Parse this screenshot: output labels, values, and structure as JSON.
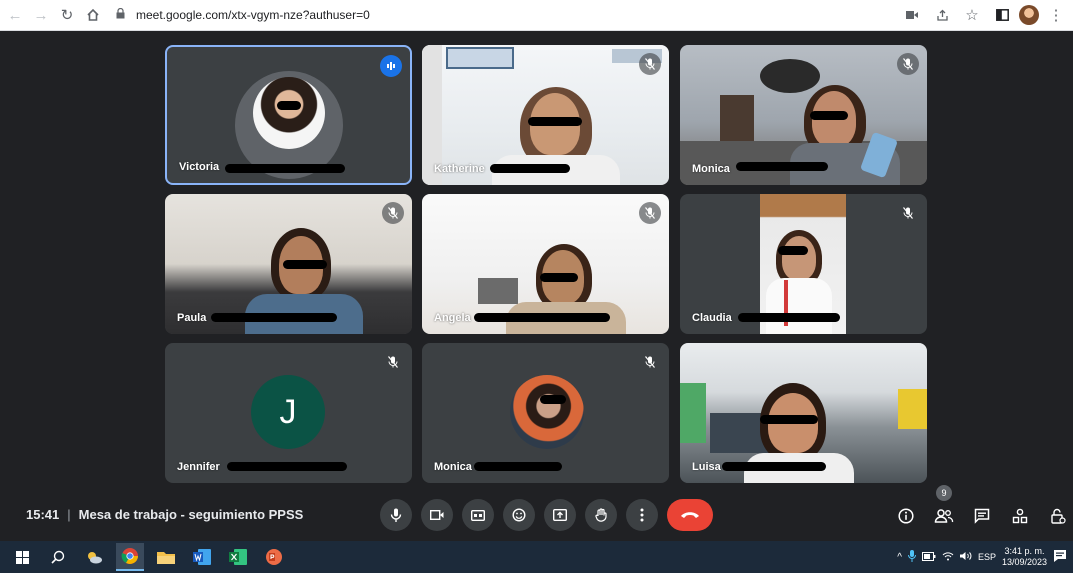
{
  "browser": {
    "url": "meet.google.com/xtx-vgym-nze?authuser=0"
  },
  "participants": [
    {
      "name": "Victoria",
      "speaking": true
    },
    {
      "name": "Katherine",
      "muted": true
    },
    {
      "name": "Monica",
      "muted": true
    },
    {
      "name": "Paula",
      "muted": true
    },
    {
      "name": "Angela",
      "muted": true
    },
    {
      "name": "Claudia",
      "muted": true
    },
    {
      "name": "Jennifer",
      "muted": true,
      "avatar_letter": "J",
      "avatar_color": "#0b5345"
    },
    {
      "name": "Monica",
      "muted": true
    },
    {
      "name": "Luisa"
    }
  ],
  "meeting": {
    "time": "15:41",
    "separator": "|",
    "title": "Mesa de trabajo - seguimiento PPSS",
    "participant_count": "9"
  },
  "taskbar": {
    "language": "ESP",
    "time": "3:41 p. m.",
    "date": "13/09/2023"
  },
  "colors": {
    "accent": "#8ab4f8",
    "hangup": "#ea4335",
    "speaking": "#1a73e8"
  }
}
